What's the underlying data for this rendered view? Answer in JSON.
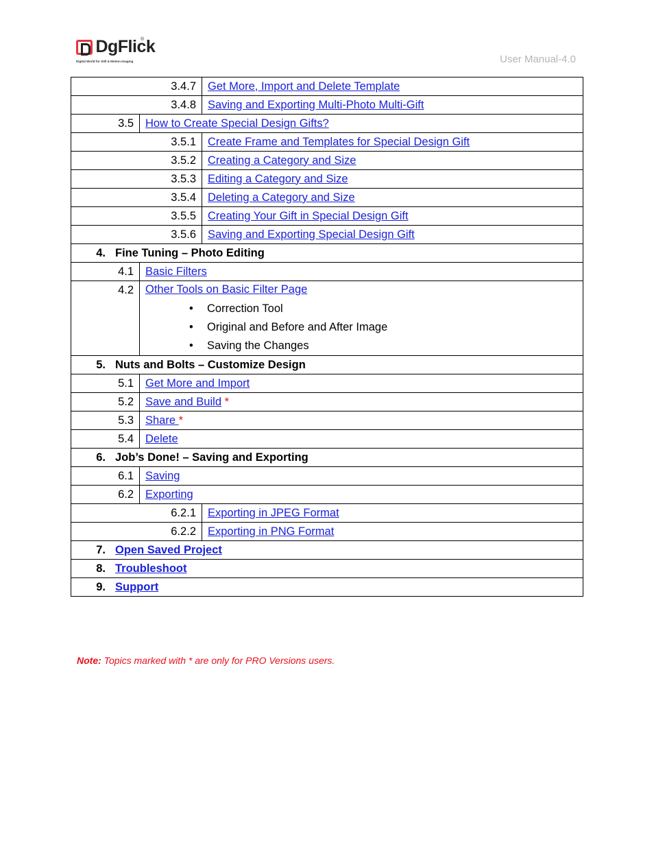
{
  "header": {
    "brand": "DgFlick",
    "tagline": "Digital World for Still & Motion Imaging",
    "doc_label": "User Manual-4.0"
  },
  "toc": {
    "r347": {
      "num": "3.4.7",
      "text": "Get More, Import and Delete Template"
    },
    "r348": {
      "num": "3.4.8",
      "text": "Saving and Exporting Multi-Photo Multi-Gift"
    },
    "r35": {
      "num": "3.5",
      "text": "How to Create Special Design Gifts?"
    },
    "r351": {
      "num": "3.5.1",
      "text": "Create Frame and Templates for Special Design Gift"
    },
    "r352": {
      "num": "3.5.2",
      "text": "Creating a Category and Size"
    },
    "r353": {
      "num": "3.5.3",
      "text": "Editing a Category and Size"
    },
    "r354": {
      "num": "3.5.4",
      "text": "Deleting a Category and Size"
    },
    "r355": {
      "num": "3.5.5",
      "text": "Creating Your Gift in Special Design Gift"
    },
    "r356": {
      "num": "3.5.6",
      "text": "Saving and Exporting Special Design Gift"
    },
    "c4": {
      "num": "4.",
      "text": "Fine Tuning – Photo Editing"
    },
    "r41": {
      "num": "4.1",
      "text": "Basic Filters"
    },
    "r42": {
      "num": "4.2",
      "text": "Other Tools on Basic Filter Page",
      "bullets": [
        "Correction Tool",
        "Original and Before and After Image",
        "Saving the Changes"
      ]
    },
    "c5": {
      "num": "5.",
      "text": "Nuts and Bolts – Customize Design"
    },
    "r51": {
      "num": "5.1",
      "text": "Get More and Import"
    },
    "r52": {
      "num": "5.2",
      "text": "Save and Build",
      "star": "*"
    },
    "r53": {
      "num": "5.3",
      "text": "Share ",
      "star": "*"
    },
    "r54": {
      "num": "5.4",
      "text": "Delete"
    },
    "c6": {
      "num": "6.",
      "text": "Job’s Done! – Saving and Exporting"
    },
    "r61": {
      "num": "6.1",
      "text": "Saving"
    },
    "r62": {
      "num": "6.2",
      "text": "Exporting"
    },
    "r621": {
      "num": "6.2.1",
      "text": "Exporting in JPEG Format"
    },
    "r622": {
      "num": "6.2.2",
      "text": "Exporting in PNG Format"
    },
    "c7": {
      "num": "7.",
      "text": "Open Saved Project"
    },
    "c8": {
      "num": "8.",
      "text": "Troubleshoot"
    },
    "c9": {
      "num": "9.",
      "text": "Support"
    }
  },
  "note": {
    "label": "Note:",
    "text": " Topics marked with * are only for PRO Versions users."
  }
}
